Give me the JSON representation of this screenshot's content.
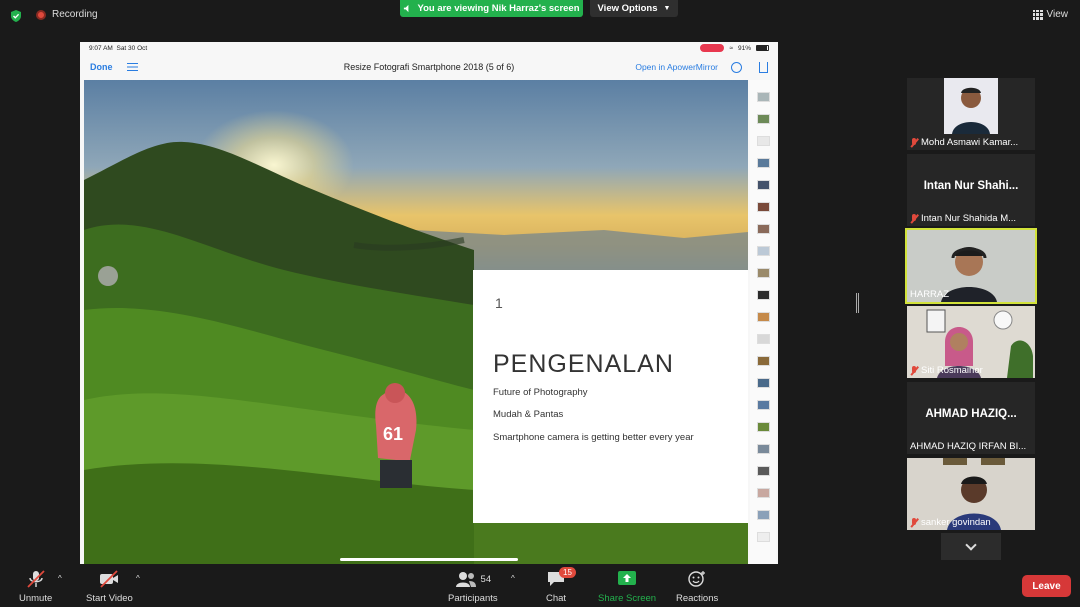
{
  "top": {
    "recording_label": "Recording",
    "viewing_label": "You are viewing Nik Harraz's screen",
    "view_options_label": "View Options",
    "view_label": "View"
  },
  "ipad": {
    "status_time": "9:07 AM",
    "status_date": "Sat 30 Oct",
    "battery": "91%",
    "done_label": "Done",
    "doc_title": "Resize Fotografi Smartphone 2018 (5 of 6)",
    "open_in_label": "Open in ApowerMirror"
  },
  "slide": {
    "number": "1",
    "heading": "PENGENALAN",
    "lines": [
      "Future of Photography",
      "Mudah & Pantas",
      "Smartphone camera is getting better every year"
    ],
    "shirt_number": "61"
  },
  "participants_panel": {
    "tiles": [
      {
        "name": "Mohd Asmawi Kamar...",
        "big": "",
        "muted": true
      },
      {
        "name": "Intan Nur Shahida M...",
        "big": "Intan Nur Shahi...",
        "muted": true
      },
      {
        "name": "HARRAZ",
        "big": "",
        "muted": false,
        "active": true
      },
      {
        "name": "Siti Rosmainor",
        "big": "",
        "muted": true
      },
      {
        "name": "AHMAD HAZIQ IRFAN BI...",
        "big": "AHMAD  HAZIQ...",
        "muted": false
      },
      {
        "name": "sanker govindan",
        "big": "",
        "muted": true
      }
    ]
  },
  "toolbar": {
    "unmute_label": "Unmute",
    "start_video_label": "Start Video",
    "participants_label": "Participants",
    "participants_count": "54",
    "chat_label": "Chat",
    "chat_badge": "15",
    "share_label": "Share Screen",
    "reactions_label": "Reactions",
    "leave_label": "Leave"
  },
  "colors": {
    "share_green": "#23b14d",
    "leave_red": "#d63838",
    "active_border": "#d2e23a",
    "link_blue": "#2a7de1"
  }
}
